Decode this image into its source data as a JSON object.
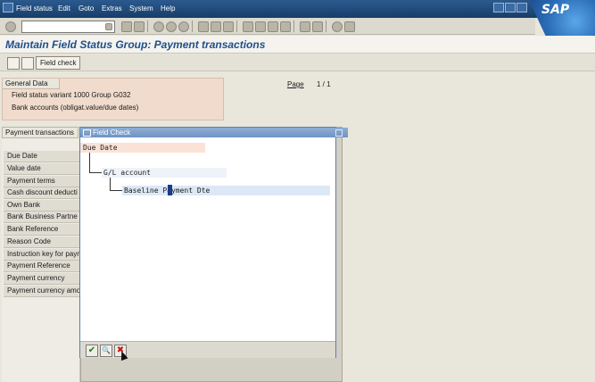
{
  "menu": [
    "Field status",
    "Edit",
    "Goto",
    "Extras",
    "System",
    "Help"
  ],
  "brand": "SAP",
  "title": "Maintain Field Status Group: Payment transactions",
  "app_toolbar": {
    "field_check_label": "Field check"
  },
  "general": {
    "header": "General Data",
    "variant_line": "Field status variant 1000   Group G032",
    "desc_line": "Bank accounts (obligat.value/due dates)"
  },
  "page": {
    "label": "Page",
    "value": "1 / 1"
  },
  "payment_tab": "Payment transactions",
  "list_items": [
    "Due Date",
    "Value date",
    "Payment terms",
    "Cash discount deducti",
    "Own Bank",
    "Bank Business Partne",
    "Bank Reference",
    "Reason Code",
    "Instruction key for paym",
    "Payment Reference",
    "Payment currency",
    "Payment currency amo"
  ],
  "dialog": {
    "title": "Field Check",
    "tree": {
      "node1": "Due Date",
      "node2": "G/L account",
      "node3": "Baseline Payment Dte"
    },
    "buttons": {
      "ok_glyph": "✔",
      "find_glyph": "🔍",
      "cancel_glyph": "✖"
    }
  },
  "colors": {
    "title": "#1f4e8c",
    "menubar": "#173d6a",
    "general_panel": "#f0dbcc",
    "dialog_title": "#6f93c2",
    "node1_highlight": "#fbe2d6"
  }
}
